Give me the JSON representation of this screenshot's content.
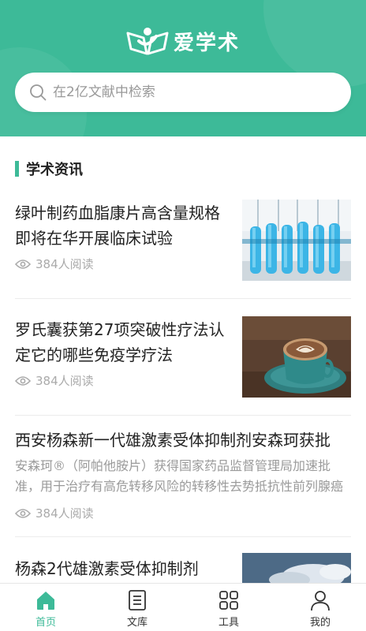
{
  "header": {
    "brand": "爱学术",
    "search_placeholder": "在2亿文献中检索"
  },
  "section": {
    "title": "学术资讯"
  },
  "articles": [
    {
      "title": "绿叶制药血脂康片高含量规格即将在华开展临床试验",
      "reads": "384人阅读",
      "image": "lab-test-tubes"
    },
    {
      "title": "罗氏囊获第27项突破性疗法认定它的哪些免疫学疗法",
      "reads": "384人阅读",
      "image": "coffee-cup"
    },
    {
      "title": "西安杨森新一代雄激素受体抑制剂安森珂获批",
      "summary": "安森珂®（阿帕他胺片）获得国家药品监督管理局加速批准，用于治疗有高危转移风险的转移性去势抵抗性前列腺癌",
      "reads": "384人阅读"
    },
    {
      "title": "杨森2代雄激素受体抑制剂",
      "image": "sky-clouds"
    }
  ],
  "nav": [
    {
      "label": "首页",
      "icon": "home-icon",
      "active": true
    },
    {
      "label": "文库",
      "icon": "document-icon",
      "active": false
    },
    {
      "label": "工具",
      "icon": "grid-icon",
      "active": false
    },
    {
      "label": "我的",
      "icon": "user-icon",
      "active": false
    }
  ],
  "colors": {
    "accent": "#3dba98"
  }
}
